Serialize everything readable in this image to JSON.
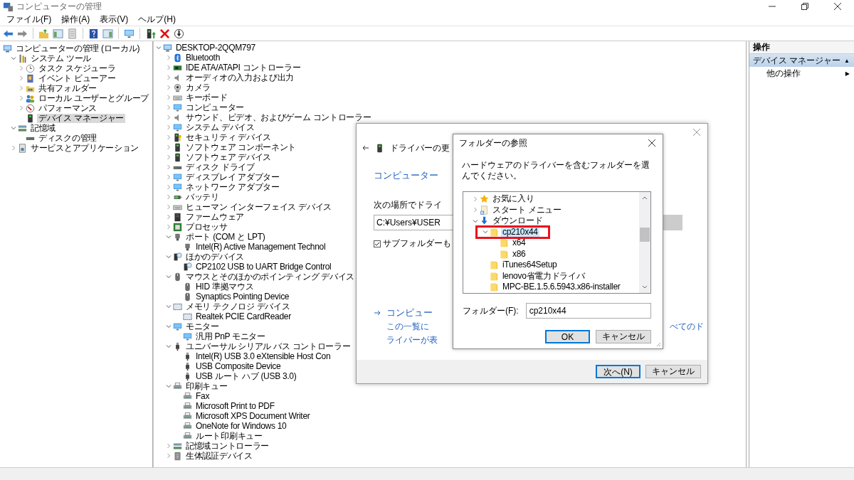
{
  "window": {
    "title": "コンピューターの管理"
  },
  "menu": [
    "ファイル(F)",
    "操作(A)",
    "表示(V)",
    "ヘルプ(H)"
  ],
  "left_tree": [
    {
      "name": "コンピューターの管理 (ローカル)",
      "kind": "computer",
      "selected": false,
      "children": [
        {
          "name": "システム ツール",
          "kind": "tools",
          "expanded": true,
          "selected": false,
          "children": [
            {
              "name": "タスク スケジューラ",
              "kind": "clock",
              "expanded": false,
              "selected": false
            },
            {
              "name": "イベント ビューアー",
              "kind": "book",
              "expanded": false,
              "selected": false
            },
            {
              "name": "共有フォルダー",
              "kind": "share",
              "expanded": false,
              "selected": false
            },
            {
              "name": "ローカル ユーザーとグループ",
              "kind": "users",
              "expanded": false,
              "selected": false
            },
            {
              "name": "パフォーマンス",
              "kind": "gauge",
              "expanded": false,
              "selected": false
            },
            {
              "name": "デバイス マネージャー",
              "kind": "device",
              "selected": true
            }
          ]
        },
        {
          "name": "記憶域",
          "kind": "storage",
          "expanded": true,
          "selected": false,
          "children": [
            {
              "name": "ディスクの管理",
              "kind": "disk",
              "selected": false
            }
          ]
        },
        {
          "name": "サービスとアプリケーション",
          "kind": "services",
          "expanded": false,
          "selected": false
        }
      ]
    }
  ],
  "device_tree": [
    {
      "name": "DESKTOP-2QQM797",
      "kind": "computer",
      "expanded": true,
      "children": [
        {
          "name": "Bluetooth",
          "kind": "bluetooth",
          "expanded": false
        },
        {
          "name": "IDE ATA/ATAPI コントローラー",
          "kind": "chip",
          "expanded": false
        },
        {
          "name": "オーディオの入力および出力",
          "kind": "speaker",
          "expanded": false
        },
        {
          "name": "カメラ",
          "kind": "camera",
          "expanded": false
        },
        {
          "name": "キーボード",
          "kind": "keyboard",
          "expanded": false
        },
        {
          "name": "コンピューター",
          "kind": "monitor",
          "expanded": false
        },
        {
          "name": "サウンド、ビデオ、およびゲーム コントローラー",
          "kind": "speaker",
          "expanded": false
        },
        {
          "name": "システム デバイス",
          "kind": "monitor",
          "expanded": false
        },
        {
          "name": "セキュリティ デバイス",
          "kind": "security",
          "expanded": false
        },
        {
          "name": "ソフトウェア コンポーネント",
          "kind": "device",
          "expanded": false
        },
        {
          "name": "ソフトウェア デバイス",
          "kind": "device",
          "expanded": false
        },
        {
          "name": "ディスク ドライブ",
          "kind": "disk",
          "expanded": false
        },
        {
          "name": "ディスプレイ アダプター",
          "kind": "monitor",
          "expanded": false
        },
        {
          "name": "ネットワーク アダプター",
          "kind": "monitor",
          "expanded": false
        },
        {
          "name": "バッテリ",
          "kind": "battery",
          "expanded": false
        },
        {
          "name": "ヒューマン インターフェイス デバイス",
          "kind": "keyboard",
          "expanded": false
        },
        {
          "name": "ファームウェア",
          "kind": "firmware",
          "expanded": false
        },
        {
          "name": "プロセッサ",
          "kind": "processor",
          "expanded": false
        },
        {
          "name": "ポート (COM と LPT)",
          "kind": "port",
          "expanded": true,
          "children": [
            {
              "name": "Intel(R) Active Management Technol",
              "kind": "port"
            }
          ]
        },
        {
          "name": "ほかのデバイス",
          "kind": "unknown",
          "expanded": true,
          "children": [
            {
              "name": "CP2102 USB to UART Bridge Control",
              "kind": "unknown"
            }
          ]
        },
        {
          "name": "マウスとそのほかのポインティング デバイス",
          "kind": "mouse",
          "expanded": true,
          "children": [
            {
              "name": "HID 準拠マウス",
              "kind": "mouse"
            },
            {
              "name": "Synaptics Pointing Device",
              "kind": "mouse"
            }
          ]
        },
        {
          "name": "メモリ テクノロジ デバイス",
          "kind": "card",
          "expanded": true,
          "children": [
            {
              "name": "Realtek PCIE CardReader",
              "kind": "card"
            }
          ]
        },
        {
          "name": "モニター",
          "kind": "monitor",
          "expanded": true,
          "children": [
            {
              "name": "汎用 PnP モニター",
              "kind": "monitor"
            }
          ]
        },
        {
          "name": "ユニバーサル シリアル バス コントローラー",
          "kind": "usb",
          "expanded": true,
          "children": [
            {
              "name": "Intel(R) USB 3.0 eXtensible Host Con",
              "kind": "usb"
            },
            {
              "name": "USB Composite Device",
              "kind": "usb"
            },
            {
              "name": "USB ルート ハブ (USB 3.0)",
              "kind": "usb"
            }
          ]
        },
        {
          "name": "印刷キュー",
          "kind": "printer",
          "expanded": true,
          "children": [
            {
              "name": "Fax",
              "kind": "printer"
            },
            {
              "name": "Microsoft Print to PDF",
              "kind": "printer"
            },
            {
              "name": "Microsoft XPS Document Writer",
              "kind": "printer"
            },
            {
              "name": "OneNote for Windows 10",
              "kind": "printer"
            },
            {
              "name": "ルート印刷キュー",
              "kind": "printer"
            }
          ]
        },
        {
          "name": "記憶域コントローラー",
          "kind": "storage",
          "expanded": false
        },
        {
          "name": "生体認証デバイス",
          "kind": "biometric",
          "expanded": false
        }
      ]
    }
  ],
  "actions_pane": {
    "header": "操作",
    "sections": [
      {
        "title": "デバイス マネージャー",
        "toggle": "▲",
        "items": [
          {
            "label": "他の操作",
            "arrow": "▶"
          }
        ]
      }
    ]
  },
  "update_wizard": {
    "title": "ドライバーの更",
    "heading": "コンピューター",
    "location_label": "次の場所でドライ",
    "path_value": "C:¥Users¥USER",
    "include_subfolders": {
      "label": "サブフォルダーも",
      "checked": true
    },
    "pick_link": "コンピュー",
    "pick_description": [
      "この一覧に",
      "ライバーが表"
    ],
    "pick_description_tail": "べてのド",
    "buttons": [
      {
        "label": "次へ(N)",
        "default": true
      },
      {
        "label": "キャンセル",
        "default": false
      }
    ]
  },
  "browse_dialog": {
    "title": "フォルダーの参照",
    "instruction": "ハードウェアのドライバーを含むフォルダーを選んでください。",
    "folders": [
      {
        "name": "お気に入り",
        "kind": "star",
        "expanded": false,
        "selected": false
      },
      {
        "name": "スタート メニュー",
        "kind": "shortcut",
        "expanded": false,
        "selected": false
      },
      {
        "name": "ダウンロード",
        "kind": "download",
        "expanded": true,
        "selected": false,
        "children": [
          {
            "name": "cp210x44",
            "kind": "folder",
            "expanded": true,
            "selected": true,
            "highlighted": true,
            "children": [
              {
                "name": "x64",
                "kind": "folder",
                "selected": false
              },
              {
                "name": "x86",
                "kind": "folder",
                "selected": false
              }
            ]
          },
          {
            "name": "iTunes64Setup",
            "kind": "folder",
            "selected": false
          },
          {
            "name": "lenovo省電力ドライバ",
            "kind": "folder",
            "selected": false
          },
          {
            "name": "MPC-BE.1.5.6.5943.x86-installer",
            "kind": "folder",
            "selected": false
          }
        ]
      }
    ],
    "folder_label": "フォルダー(F):",
    "folder_value": "cp210x44",
    "buttons": [
      {
        "label": "OK",
        "default": true
      },
      {
        "label": "キャンセル",
        "default": false
      }
    ]
  }
}
